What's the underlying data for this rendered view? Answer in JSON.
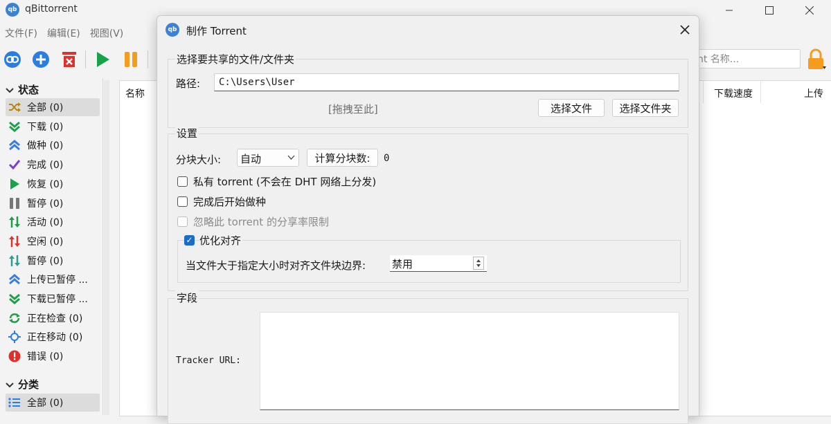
{
  "window": {
    "app_icon_text": "qb",
    "title": "qBittorrent"
  },
  "menu": {
    "items": [
      "文件(F)",
      "编辑(E)",
      "视图(V)"
    ]
  },
  "search": {
    "placeholder": "nt 名称..."
  },
  "sidebar": {
    "status_header": "状态",
    "status_items": [
      {
        "label": "全部 (0)",
        "icon": "shuffle-icon",
        "color": "#b8860b"
      },
      {
        "label": "下载 (0)",
        "icon": "double-chevron-down-icon",
        "color": "#1e9e4a"
      },
      {
        "label": "做种 (0)",
        "icon": "double-chevron-up-icon",
        "color": "#3b7ddd"
      },
      {
        "label": "完成 (0)",
        "icon": "check-icon",
        "color": "#7b3fd0"
      },
      {
        "label": "恢复 (0)",
        "icon": "play-icon",
        "color": "#18a34a"
      },
      {
        "label": "暂停 (0)",
        "icon": "pause-icon",
        "color": "#777777"
      },
      {
        "label": "活动 (0)",
        "icon": "updown-arrows-icon",
        "color": "#1e9e4a"
      },
      {
        "label": "空闲 (0)",
        "icon": "updown-arrows-icon",
        "color": "#e0302a"
      },
      {
        "label": "暂停 (0)",
        "icon": "updown-arrows-icon",
        "color": "#2a9d8f"
      },
      {
        "label": "上传已暂停 ...",
        "icon": "double-chevron-up-icon",
        "color": "#3b7ddd"
      },
      {
        "label": "下载已暂停 ...",
        "icon": "double-chevron-down-icon",
        "color": "#1e9e4a"
      },
      {
        "label": "正在检查 (0)",
        "icon": "refresh-icon",
        "color": "#1e9e4a"
      },
      {
        "label": "正在移动 (0)",
        "icon": "crosshair-icon",
        "color": "#2b7de0"
      },
      {
        "label": "错误 (0)",
        "icon": "error-icon",
        "color": "#e0302a"
      }
    ],
    "category_header": "分类",
    "category_items": [
      {
        "label": "全部 (0)",
        "icon": "list-icon",
        "color": "#2b7de0"
      }
    ]
  },
  "main": {
    "columns": [
      "名称",
      "下载速度",
      "上传"
    ]
  },
  "dialog": {
    "icon_text": "qb",
    "title": "制作 Torrent",
    "source_group": {
      "title": "选择要共享的文件/文件夹",
      "path_label": "路径:",
      "path_value": "C:\\Users\\User",
      "drop_hint": "[拖拽至此]",
      "select_file": "选择文件",
      "select_folder": "选择文件夹"
    },
    "settings_group": {
      "title": "设置",
      "piece_size_label": "分块大小:",
      "piece_size_value": "自动",
      "calc_button": "计算分块数:",
      "piece_count": "0",
      "private_label": "私有 torrent (不会在 DHT 网络上分发)",
      "private_checked": false,
      "start_seeding_label": "完成后开始做种",
      "start_seeding_checked": false,
      "ignore_ratio_label": "忽略此 torrent 的分享率限制",
      "ignore_ratio_checked": false,
      "optimize_label": "优化对齐",
      "optimize_checked": true,
      "align_label": "当文件大于指定大小时对齐文件块边界:",
      "align_value": "禁用"
    },
    "fields_group": {
      "title": "字段",
      "tracker_label": "Tracker URL:"
    }
  },
  "colors": {
    "accent": "#1d6bc9",
    "orange": "#f59b1d",
    "green": "#18a34a",
    "red": "#e0302a"
  }
}
